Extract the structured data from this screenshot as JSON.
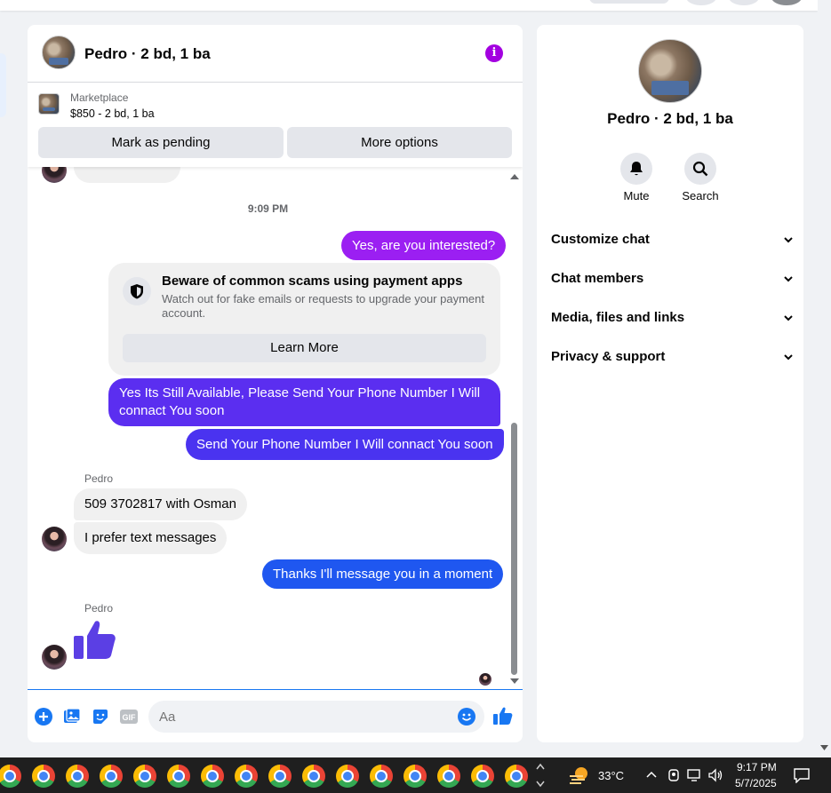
{
  "chat": {
    "title": "Pedro · 2 bd, 1 ba",
    "marketplace_label": "Marketplace",
    "listing": "$850 - 2 bd, 1 ba",
    "mark_pending": "Mark as pending",
    "more_options": "More options",
    "timestamp": "9:09 PM",
    "warning": {
      "title": "Beware of common scams using payment apps",
      "body": "Watch out for fake emails or requests to upgrade your payment account.",
      "button": "Learn More"
    },
    "messages": [
      {
        "from": "me",
        "text": "Yes, are you interested?"
      },
      {
        "from": "me",
        "text": "Yes Its Still Available, Please Send Your Phone Number I Will connact You soon"
      },
      {
        "from": "me",
        "text": "Send Your Phone Number I Will connact You soon"
      },
      {
        "from": "Pedro",
        "sender": "Pedro",
        "text": "509 3702817 with Osman"
      },
      {
        "from": "Pedro",
        "text": "I prefer text messages"
      },
      {
        "from": "me",
        "text": "Thanks I'll message you in a moment"
      },
      {
        "from": "Pedro",
        "sender": "Pedro",
        "text": "",
        "sticker": "thumbs-up-icon"
      }
    ],
    "composer_placeholder": "Aa",
    "colors": {
      "bubble_purple": "#9b1ff2",
      "bubble_violet": "#5b2ef0",
      "bubble_blue": "#1f57f0",
      "accent": "#1877f2",
      "info_icon": "#a300e0"
    }
  },
  "info": {
    "name": "Pedro · 2 bd, 1 ba",
    "mute": "Mute",
    "search": "Search",
    "sections": [
      "Customize chat",
      "Chat members",
      "Media, files and links",
      "Privacy & support"
    ]
  },
  "taskbar": {
    "temperature": "33°C",
    "time": "9:17 PM",
    "date": "5/7/2025"
  }
}
